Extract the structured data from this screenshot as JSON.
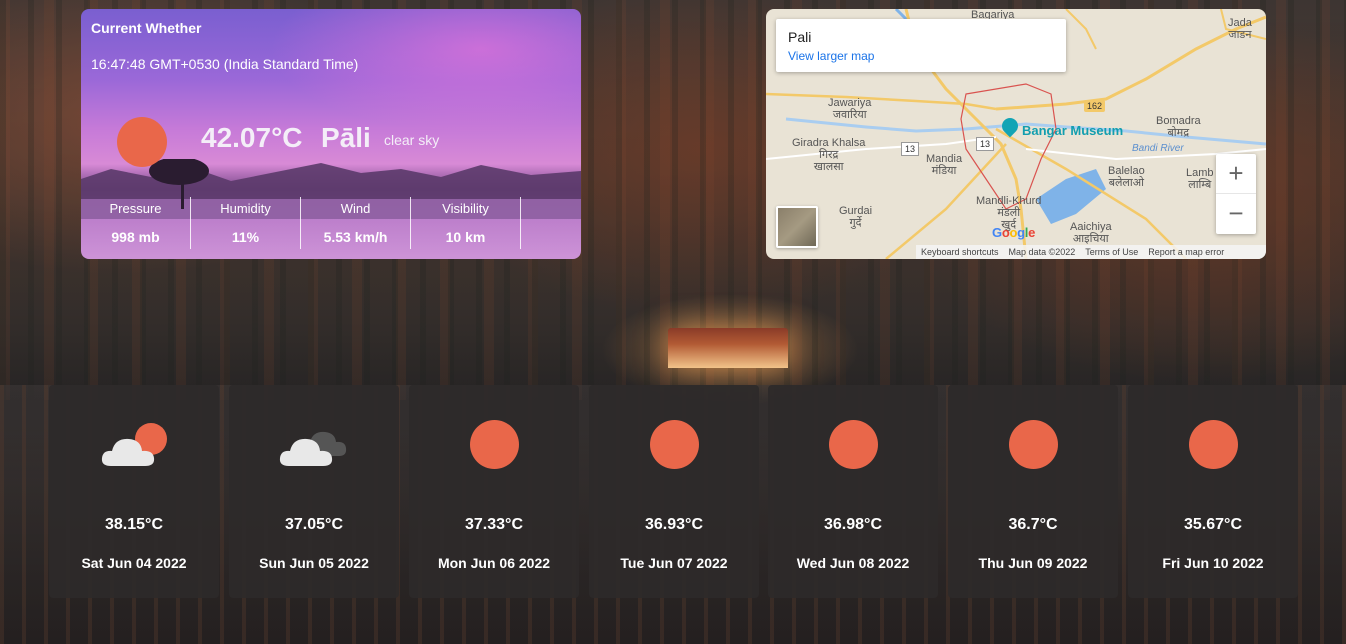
{
  "current": {
    "title": "Current Whether",
    "time": "16:47:48 GMT+0530 (India Standard Time)",
    "temperature": "42.07°C",
    "city": "Pāli",
    "description": "clear sky",
    "icon": "sun-icon",
    "stats": [
      {
        "label": "Pressure",
        "value": "998 mb"
      },
      {
        "label": "Humidity",
        "value": "11%"
      },
      {
        "label": "Wind",
        "value": "5.53 km/h"
      },
      {
        "label": "Visibility",
        "value": "10 km"
      }
    ]
  },
  "map": {
    "place": "Pali",
    "larger_map": "View larger map",
    "zoom_in": "+",
    "zoom_out": "−",
    "museum": "Bangar Museum",
    "road_162": "162",
    "road_13a": "13",
    "road_13b": "13",
    "labels": {
      "bagariya": "Bagariya\nबगरिया",
      "jada": "Jada\nजाडन",
      "jawariya": "Jawariya\nजवारिया",
      "giradra": "Giradra Khalsa\nगिरद्र\nखालसा",
      "mandia": "Mandia\nमंडिया",
      "bomadra": "Bomadra\nबोमद्र",
      "bandi_river": "Bandi River",
      "balelao": "Balelao\nबलेलाओ",
      "lamba": "Lamb\nलाम्बि",
      "mandli": "Mandli-Khurd\nमंडली\nखुर्द",
      "gurdai": "Gurdai\nगुर्दे",
      "aaichiya": "Aaichiya\nआइचिया"
    },
    "footer": {
      "shortcuts": "Keyboard shortcuts",
      "data": "Map data ©2022",
      "terms": "Terms of Use",
      "report": "Report a map error"
    },
    "logo": "Google"
  },
  "forecast": [
    {
      "icon": "cloud-sun-icon",
      "temp": "38.15°C",
      "date": "Sat Jun 04 2022"
    },
    {
      "icon": "cloud-overcast-icon",
      "temp": "37.05°C",
      "date": "Sun Jun 05 2022"
    },
    {
      "icon": "sun-icon",
      "temp": "37.33°C",
      "date": "Mon Jun 06 2022"
    },
    {
      "icon": "sun-icon",
      "temp": "36.93°C",
      "date": "Tue Jun 07 2022"
    },
    {
      "icon": "sun-icon",
      "temp": "36.98°C",
      "date": "Wed Jun 08 2022"
    },
    {
      "icon": "sun-icon",
      "temp": "36.7°C",
      "date": "Thu Jun 09 2022"
    },
    {
      "icon": "sun-icon",
      "temp": "35.67°C",
      "date": "Fri Jun 10 2022"
    }
  ],
  "colors": {
    "sun": "#e9674a",
    "card_bg": "#2d2a2a",
    "map_link": "#1a73e8",
    "museum": "#129eaf"
  }
}
